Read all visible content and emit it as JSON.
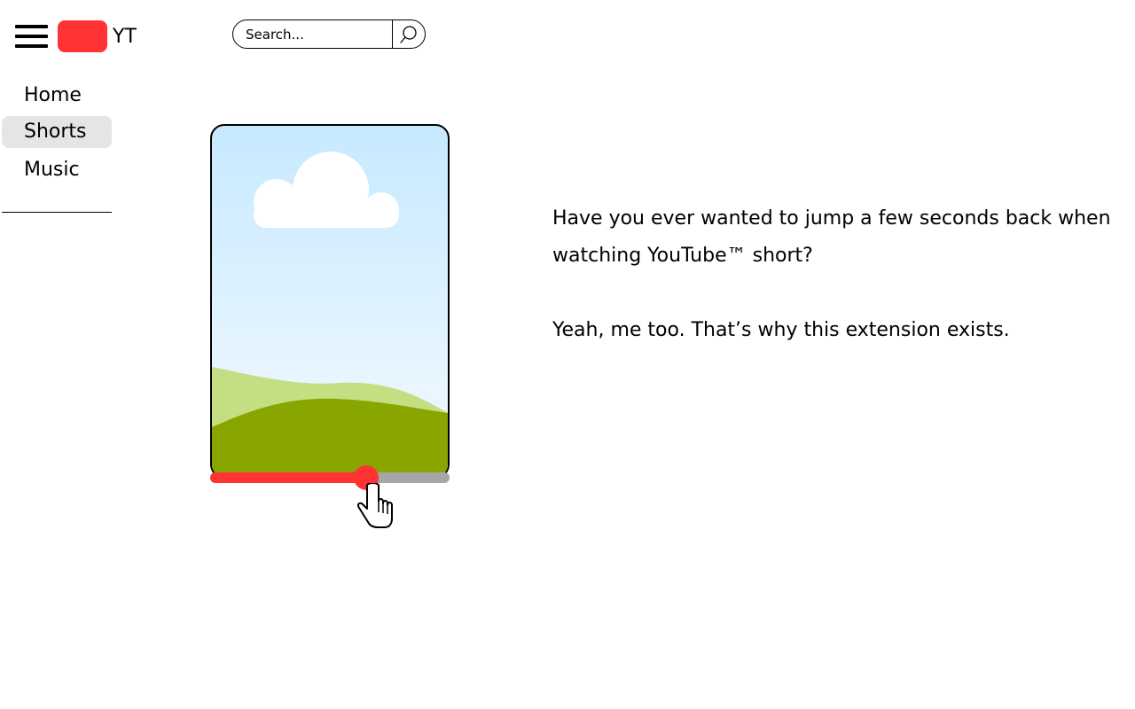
{
  "header": {
    "menu_icon": "hamburger-menu-icon",
    "logo_text": "YT",
    "logo_color": "#ff3333",
    "search": {
      "placeholder": "Search...",
      "value": "",
      "icon": "search-icon"
    }
  },
  "sidebar": {
    "items": [
      {
        "label": "Home",
        "active": false
      },
      {
        "label": "Shorts",
        "active": true
      },
      {
        "label": "Music",
        "active": false
      }
    ]
  },
  "player": {
    "progress_fraction": 0.65,
    "progress_color": "#ff3333",
    "track_color": "#a6a6a6",
    "cursor_icon": "pointer-hand-icon"
  },
  "description": {
    "line1": "Have you ever wanted to jump a few seconds back when watching YouTube™ short?",
    "line2": "Yeah, me too. That’s why this extension exists."
  }
}
